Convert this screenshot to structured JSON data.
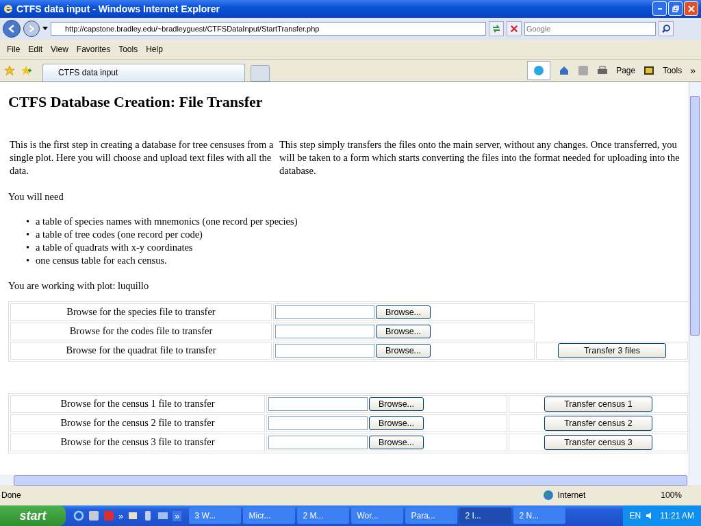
{
  "window": {
    "title": "CTFS data input - Windows Internet Explorer"
  },
  "address_bar": {
    "url": "http://capstone.bradley.edu/~bradleyguest/CTFSDataInput/StartTransfer.php"
  },
  "search": {
    "placeholder": "Google"
  },
  "menu": [
    "File",
    "Edit",
    "View",
    "Favorites",
    "Tools",
    "Help"
  ],
  "tab": {
    "title": "CTFS data input"
  },
  "command_bar": {
    "page": "Page",
    "tools": "Tools",
    "more": "»"
  },
  "page": {
    "heading": "CTFS Database Creation: File Transfer",
    "intro_left": "This is the first step in creating a database for tree censuses from a single plot. Here you will choose and upload text files with all the data.",
    "intro_right": "This step simply transfers the files onto the main server, without any changes. Once transferred, you will be taken to a form which starts converting the files into the format needed for uploading into the database.",
    "need_label": "You will need",
    "need_items": [
      {
        "bullet": "•",
        "text": "a table of species names with mnemonics (one record per species)"
      },
      {
        "bullet": "•",
        "text": "a table of tree codes (one record per code)"
      },
      {
        "bullet": "•",
        "text": "a table of quadrats with x-y coordinates"
      },
      {
        "bullet": "•",
        "text": "one census table for each census."
      }
    ],
    "plot_line": "You are working with plot: luquillo",
    "file_rows": [
      {
        "label": "Browse for the species file to transfer",
        "browse": "Browse..."
      },
      {
        "label": "Browse for the codes file to transfer",
        "browse": "Browse..."
      },
      {
        "label": "Browse for the quadrat file to transfer",
        "browse": "Browse..."
      }
    ],
    "transfer_files": "Transfer 3 files",
    "census_rows": [
      {
        "label": "Browse for the census 1 file to transfer",
        "browse": "Browse...",
        "button": "Transfer census 1"
      },
      {
        "label": "Browse for the census 2 file to transfer",
        "browse": "Browse...",
        "button": "Transfer census 2"
      },
      {
        "label": "Browse for the census 3 file to transfer",
        "browse": "Browse...",
        "button": "Transfer census 3"
      }
    ]
  },
  "status_bar": {
    "text": "Done",
    "zone": "Internet",
    "zoom": "100%"
  },
  "taskbar": {
    "start": "start",
    "quick_more": "»",
    "task_more": "»",
    "tasks": [
      {
        "label": "3 W...",
        "selected": false
      },
      {
        "label": "Micr...",
        "selected": false
      },
      {
        "label": "2 M...",
        "selected": false
      },
      {
        "label": "Wor...",
        "selected": false
      },
      {
        "label": "Para...",
        "selected": false
      },
      {
        "label": "2 I...",
        "selected": true
      },
      {
        "label": "2 N...",
        "selected": false
      }
    ],
    "language": "EN",
    "clock": "11:21 AM"
  }
}
